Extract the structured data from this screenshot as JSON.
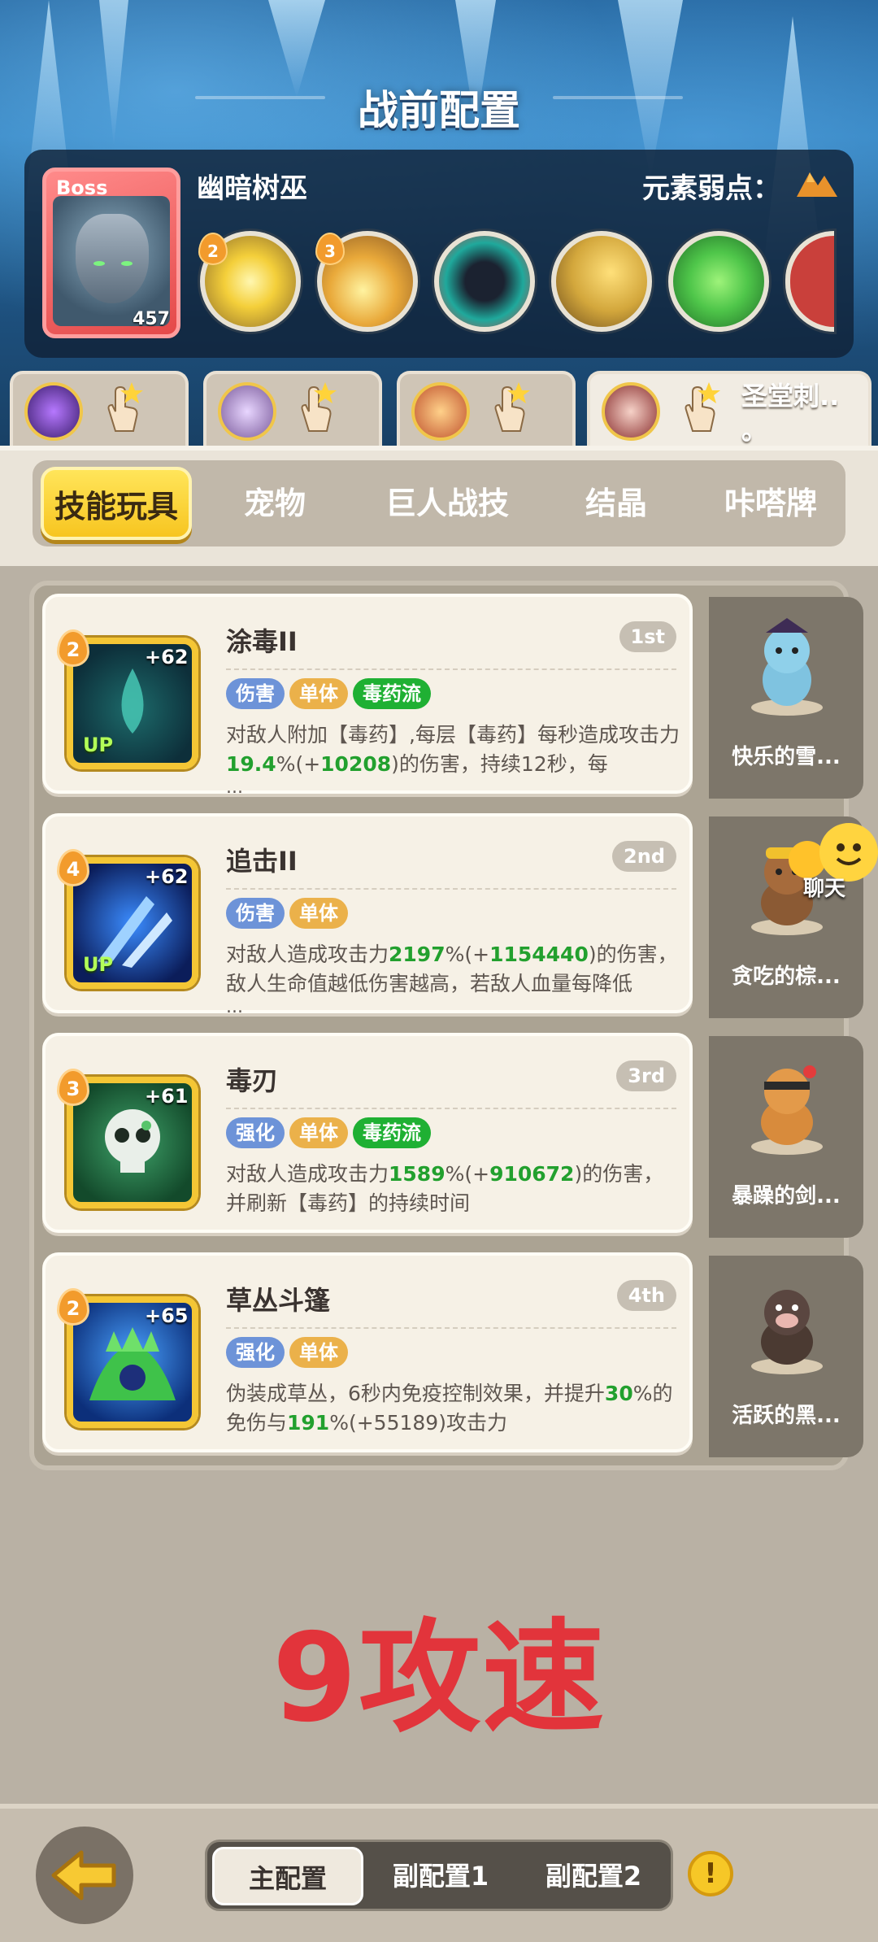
{
  "header": {
    "title": "战前配置",
    "boss": {
      "badge": "Boss",
      "level": "457",
      "name": "幽暗树巫",
      "weakness_label": "元素弱点："
    },
    "boss_skills": [
      {
        "level": "2",
        "icon": "sun-burst-orb-icon",
        "color": "#f6d55a"
      },
      {
        "level": "3",
        "icon": "fire-flame-orb-icon",
        "color": "#e9c24a"
      },
      {
        "level": "",
        "icon": "dark-creature-orb-icon",
        "color": "#1fa99c"
      },
      {
        "level": "",
        "icon": "golden-leaf-orb-icon",
        "color": "#d3a73c"
      },
      {
        "level": "",
        "icon": "green-slime-orb-icon",
        "color": "#4fc64a"
      }
    ],
    "hero_tabs": [
      {
        "name": ""
      },
      {
        "name": ""
      },
      {
        "name": ""
      },
      {
        "name": "圣堂刺..\n。"
      }
    ]
  },
  "categories": {
    "tabs": [
      "技能玩具",
      "宠物",
      "巨人战技",
      "结晶",
      "咔嗒牌"
    ],
    "active": 0
  },
  "skills": [
    {
      "name": "涂毒II",
      "rank": "1st",
      "level": "2",
      "plus": "+62",
      "up": "UP",
      "tags": [
        {
          "text": "伤害",
          "kind": "blue"
        },
        {
          "text": "单体",
          "kind": "yellow"
        },
        {
          "text": "毒药流",
          "kind": "green"
        }
      ],
      "desc_a": "对敌人附加【毒药】,每层【毒药】每秒造成攻击力",
      "desc_hl1": "19.4",
      "desc_b": "%(+",
      "desc_hl2": "10208",
      "desc_c": ")的伤害，持续12秒，每",
      "more": "...",
      "icon": "water-drop-icon",
      "pet_name": "快乐的雪...",
      "pet_icon": "snow-bunny-pet-icon"
    },
    {
      "name": "追击II",
      "rank": "2nd",
      "level": "4",
      "plus": "+62",
      "up": "UP",
      "tags": [
        {
          "text": "伤害",
          "kind": "blue"
        },
        {
          "text": "单体",
          "kind": "yellow"
        }
      ],
      "desc_a": "对敌人造成攻击力",
      "desc_hl1": "2197",
      "desc_b": "%(+",
      "desc_hl2": "1154440",
      "desc_c": ")的伤害，敌人生命值越低伤害越高，若敌人血量每降低",
      "more": "...",
      "icon": "blue-slash-icon",
      "pet_name": "贪吃的棕...",
      "pet_icon": "brown-bear-pet-icon"
    },
    {
      "name": "毒刃",
      "rank": "3rd",
      "level": "3",
      "plus": "+61",
      "up": "",
      "tags": [
        {
          "text": "强化",
          "kind": "blue"
        },
        {
          "text": "单体",
          "kind": "yellow"
        },
        {
          "text": "毒药流",
          "kind": "green"
        }
      ],
      "desc_a": "对敌人造成攻击力",
      "desc_hl1": "1589",
      "desc_b": "%(+",
      "desc_hl2": "910672",
      "desc_c": ")的伤害，并刷新【毒药】的持续时间",
      "more": "",
      "icon": "poison-skull-icon",
      "pet_name": "暴躁的剑...",
      "pet_icon": "sword-cat-pet-icon"
    },
    {
      "name": "草丛斗篷",
      "rank": "4th",
      "level": "2",
      "plus": "+65",
      "up": "",
      "tags": [
        {
          "text": "强化",
          "kind": "blue"
        },
        {
          "text": "单体",
          "kind": "yellow"
        }
      ],
      "desc_a": "伪装成草丛，6秒内免疫控制效果，并提升",
      "desc_hl1": "30",
      "desc_b": "%的免伤与",
      "desc_hl2": "191",
      "desc_c": "%(+55189)攻击力",
      "more": "",
      "icon": "grass-cloak-icon",
      "pet_name": "活跃的黑...",
      "pet_icon": "black-pig-pet-icon"
    }
  ],
  "chat": {
    "label": "聊天"
  },
  "note": "9攻速",
  "footer": {
    "config_tabs": [
      "主配置",
      "副配置1",
      "副配置2"
    ],
    "active": 0,
    "alert": "!"
  },
  "colors": {
    "accent": "#f7c520",
    "highlight_green": "#22a02e",
    "note_red": "#e2343b"
  }
}
